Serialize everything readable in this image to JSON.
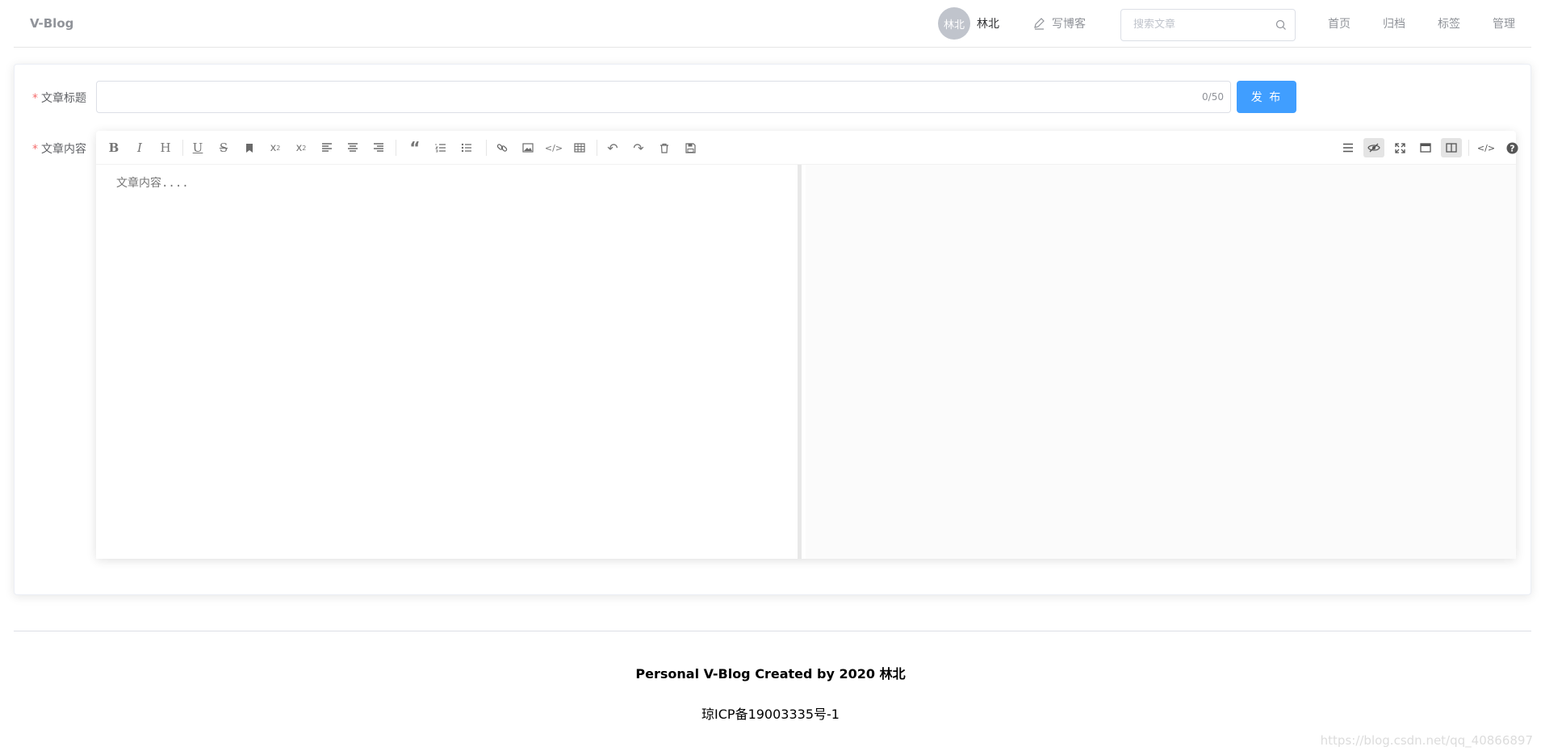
{
  "header": {
    "brand": "V-Blog",
    "user": {
      "avatar_text": "林北",
      "name": "林北"
    },
    "write_label": "写博客",
    "search_placeholder": "搜索文章",
    "nav": [
      "首页",
      "归档",
      "标签",
      "管理"
    ]
  },
  "form": {
    "title_label": "文章标题",
    "title_value": "",
    "title_count": "0/50",
    "content_label": "文章内容",
    "required_mark": "*",
    "publish_label": "发 布"
  },
  "editor": {
    "placeholder": "文章内容....",
    "toolbar_left": [
      "bold-icon",
      "italic-icon",
      "header-icon",
      "underline-icon",
      "strikethrough-icon",
      "mark-icon",
      "superscript-icon",
      "subscript-icon",
      "align-left-icon",
      "align-center-icon",
      "align-right-icon",
      "quote-icon",
      "ordered-list-icon",
      "unordered-list-icon",
      "link-icon",
      "image-icon",
      "code-icon",
      "table-icon",
      "undo-icon",
      "redo-icon",
      "trash-icon",
      "save-icon"
    ],
    "toolbar_right": [
      "navigation-icon",
      "preview-toggle-icon",
      "fullscreen-icon",
      "read-mode-icon",
      "subfield-icon",
      "html-code-icon",
      "help-icon"
    ]
  },
  "footer": {
    "main": "Personal V-Blog Created by 2020 林北",
    "icp": "琼ICP备19003335号-1"
  },
  "watermark": "https://blog.csdn.net/qq_40866897",
  "colors": {
    "primary": "#409eff",
    "required": "#f56c6c",
    "preview_bg": "#fbfbfb"
  }
}
